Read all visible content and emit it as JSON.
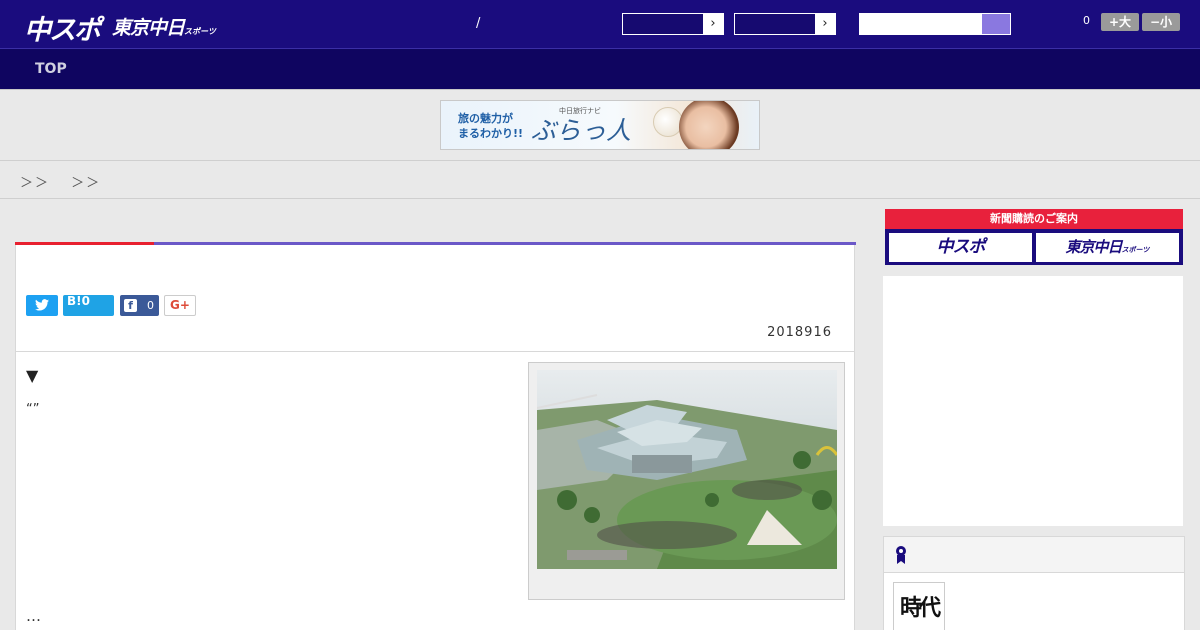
{
  "header": {
    "logo_primary": "中スポ",
    "logo_secondary": "東京中日",
    "logo_secondary_small": "スポーツ",
    "separator": "/",
    "select_arrow": "›",
    "counter": "0",
    "font_larger_label": "+大",
    "font_smaller_label": "−小"
  },
  "nav": {
    "items": [
      {
        "label": "TOP"
      }
    ]
  },
  "banner": {
    "copy_line1": "旅の魅力が",
    "copy_line2": "まるわかり!!",
    "nav_label": "中日旅行ナビ",
    "brand": "ぶらっ人"
  },
  "breadcrumb": {
    "text": "＞＞　 ＞＞"
  },
  "article": {
    "share": {
      "twitter_icon": "twitter-icon",
      "hatena_label": "B!0",
      "facebook_letter": "f",
      "facebook_count": "0",
      "gplus_label": "G+"
    },
    "date": "2018916",
    "marker": "▼",
    "quote": "“”",
    "ellipsis": "…"
  },
  "sidebar": {
    "subscribe_title": "新聞購読のご案内",
    "subscribe_btn_1": "中スポ",
    "subscribe_btn_2": "東京中日",
    "subscribe_btn_2_small": "スポーツ",
    "ranking_thumb_text": "時代"
  },
  "colors": {
    "header_bg": "#1a0c7e",
    "nav_bg": "#0f0560",
    "accent_red": "#e8202f",
    "accent_purple": "#6b58c8"
  }
}
